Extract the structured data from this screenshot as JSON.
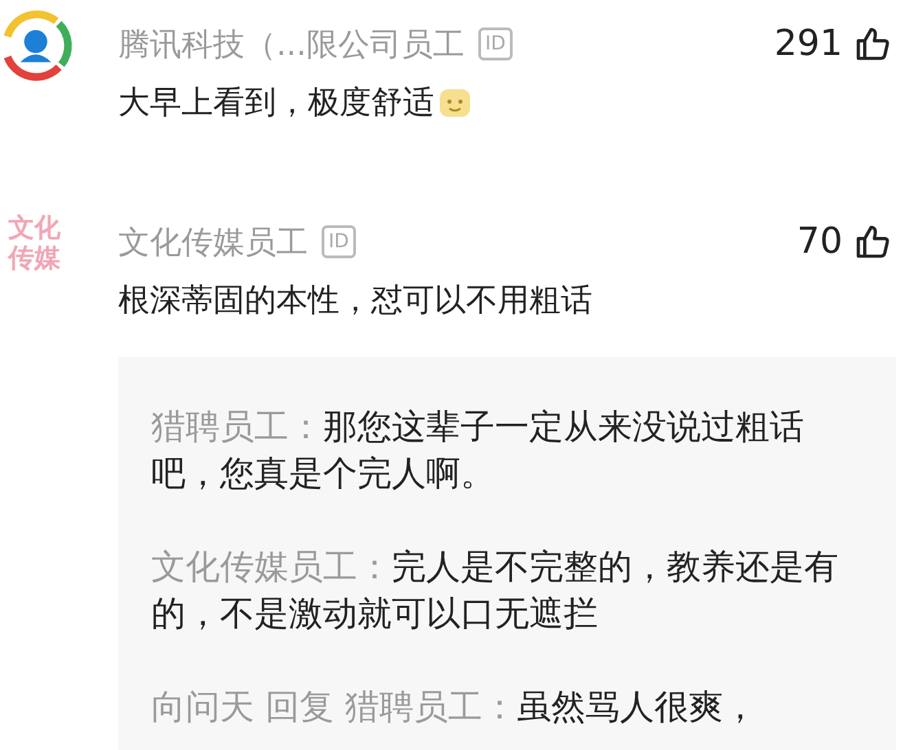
{
  "comments": [
    {
      "avatar": {
        "kind": "logo"
      },
      "author": "腾讯科技（...限公司员工",
      "badge": "ID",
      "likes": "291",
      "text": "大早上看到，极度舒适",
      "emoji": true
    },
    {
      "avatar": {
        "kind": "text",
        "lines": [
          "文化",
          "传媒"
        ]
      },
      "author": "文化传媒员工",
      "badge": "ID",
      "likes": "70",
      "text": "根深蒂固的本性，怼可以不用粗话",
      "emoji": false,
      "replies": [
        {
          "author": "猎聘员工：",
          "text": "那您这辈子一定从来没说过粗话吧，您真是个完人啊。"
        },
        {
          "author": "文化传媒员工：",
          "text": "完人是不完整的，教养还是有的，不是激动就可以口无遮拦"
        },
        {
          "author": "向问天 回复 猎聘员工：",
          "text": "虽然骂人很爽，"
        }
      ]
    }
  ]
}
